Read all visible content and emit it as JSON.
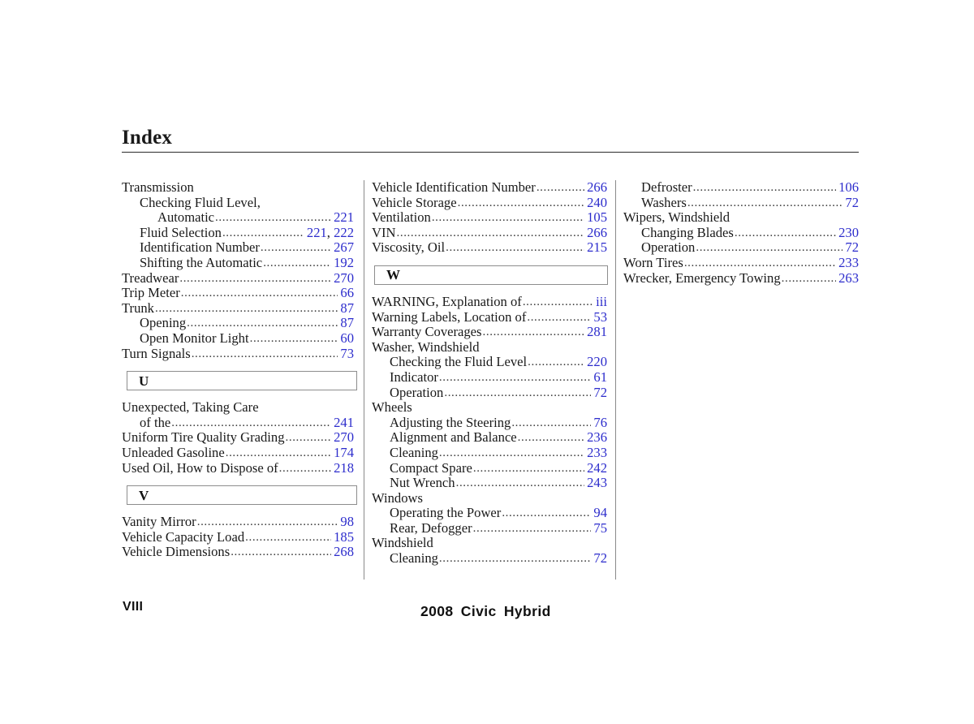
{
  "page": {
    "title": "Index",
    "footer_page_number": "VIII",
    "footer_model": "2008 Civic Hybrid",
    "leader_dots": "................................................................................................",
    "accent_color": "#2c2ccc",
    "rule_color": "#2b2b2b",
    "divider_color": "#8a8a8a"
  },
  "columns": [
    {
      "id": "column-1",
      "blocks": [
        {
          "type": "entries",
          "entries": [
            {
              "label": "Transmission",
              "level": 0,
              "page": ""
            },
            {
              "label": "Checking Fluid Level,",
              "level": 1,
              "page": ""
            },
            {
              "label": "Automatic",
              "level": 2,
              "page": "221"
            },
            {
              "label": "Fluid Selection",
              "level": 1,
              "page": "221, 222"
            },
            {
              "label": "Identification Number",
              "level": 1,
              "page": "267"
            },
            {
              "label": "Shifting the Automatic",
              "level": 1,
              "page": "192"
            },
            {
              "label": "Treadwear",
              "level": 0,
              "page": "270"
            },
            {
              "label": "Trip Meter",
              "level": 0,
              "page": "66"
            },
            {
              "label": "Trunk",
              "level": 0,
              "page": "87"
            },
            {
              "label": "Opening",
              "level": 1,
              "page": "87"
            },
            {
              "label": "Open Monitor Light",
              "level": 1,
              "page": "60"
            },
            {
              "label": "Turn Signals",
              "level": 0,
              "page": "73"
            }
          ]
        },
        {
          "type": "letter",
          "letter": "U"
        },
        {
          "type": "entries",
          "entries": [
            {
              "label": "Unexpected, Taking Care",
              "level": 0,
              "page": ""
            },
            {
              "label": "of the",
              "level": 1,
              "page": "241"
            },
            {
              "label": "Uniform Tire Quality Grading",
              "level": 0,
              "page": "270"
            },
            {
              "label": "Unleaded Gasoline",
              "level": 0,
              "page": "174"
            },
            {
              "label": "Used Oil, How to Dispose of",
              "level": 0,
              "page": "218"
            }
          ]
        },
        {
          "type": "letter",
          "letter": "V"
        },
        {
          "type": "entries",
          "entries": [
            {
              "label": "Vanity Mirror",
              "level": 0,
              "page": "98"
            },
            {
              "label": "Vehicle Capacity Load",
              "level": 0,
              "page": "185"
            },
            {
              "label": "Vehicle Dimensions",
              "level": 0,
              "page": "268"
            }
          ]
        }
      ]
    },
    {
      "id": "column-2",
      "blocks": [
        {
          "type": "entries",
          "entries": [
            {
              "label": "Vehicle Identification Number",
              "level": 0,
              "page": "266"
            },
            {
              "label": "Vehicle Storage",
              "level": 0,
              "page": "240"
            },
            {
              "label": "Ventilation",
              "level": 0,
              "page": "105"
            },
            {
              "label": "VIN",
              "level": 0,
              "page": "266"
            },
            {
              "label": "Viscosity, Oil",
              "level": 0,
              "page": "215"
            }
          ]
        },
        {
          "type": "letter",
          "letter": "W"
        },
        {
          "type": "entries",
          "entries": [
            {
              "label": "WARNING, Explanation of",
              "level": 0,
              "page": "iii"
            },
            {
              "label": "Warning Labels, Location of",
              "level": 0,
              "page": "53"
            },
            {
              "label": "Warranty Coverages",
              "level": 0,
              "page": "281"
            },
            {
              "label": "Washer, Windshield",
              "level": 0,
              "page": ""
            },
            {
              "label": "Checking the Fluid Level",
              "level": 1,
              "page": "220"
            },
            {
              "label": "Indicator",
              "level": 1,
              "page": "61"
            },
            {
              "label": "Operation",
              "level": 1,
              "page": "72"
            },
            {
              "label": "Wheels",
              "level": 0,
              "page": ""
            },
            {
              "label": "Adjusting the Steering",
              "level": 1,
              "page": "76"
            },
            {
              "label": "Alignment and Balance",
              "level": 1,
              "page": "236"
            },
            {
              "label": "Cleaning",
              "level": 1,
              "page": "233"
            },
            {
              "label": "Compact Spare",
              "level": 1,
              "page": "242"
            },
            {
              "label": "Nut Wrench",
              "level": 1,
              "page": "243"
            },
            {
              "label": "Windows",
              "level": 0,
              "page": ""
            },
            {
              "label": "Operating the Power",
              "level": 1,
              "page": "94"
            },
            {
              "label": "Rear, Defogger",
              "level": 1,
              "page": "75"
            },
            {
              "label": "Windshield",
              "level": 0,
              "page": ""
            },
            {
              "label": "Cleaning",
              "level": 1,
              "page": "72"
            }
          ]
        }
      ]
    },
    {
      "id": "column-3",
      "blocks": [
        {
          "type": "entries",
          "entries": [
            {
              "label": "Defroster",
              "level": 1,
              "page": "106"
            },
            {
              "label": "Washers",
              "level": 1,
              "page": "72"
            },
            {
              "label": "Wipers, Windshield",
              "level": 0,
              "page": ""
            },
            {
              "label": "Changing Blades",
              "level": 1,
              "page": "230"
            },
            {
              "label": "Operation",
              "level": 1,
              "page": "72"
            },
            {
              "label": "Worn Tires",
              "level": 0,
              "page": "233"
            },
            {
              "label": "Wrecker, Emergency Towing",
              "level": 0,
              "page": "263"
            }
          ]
        }
      ]
    }
  ]
}
